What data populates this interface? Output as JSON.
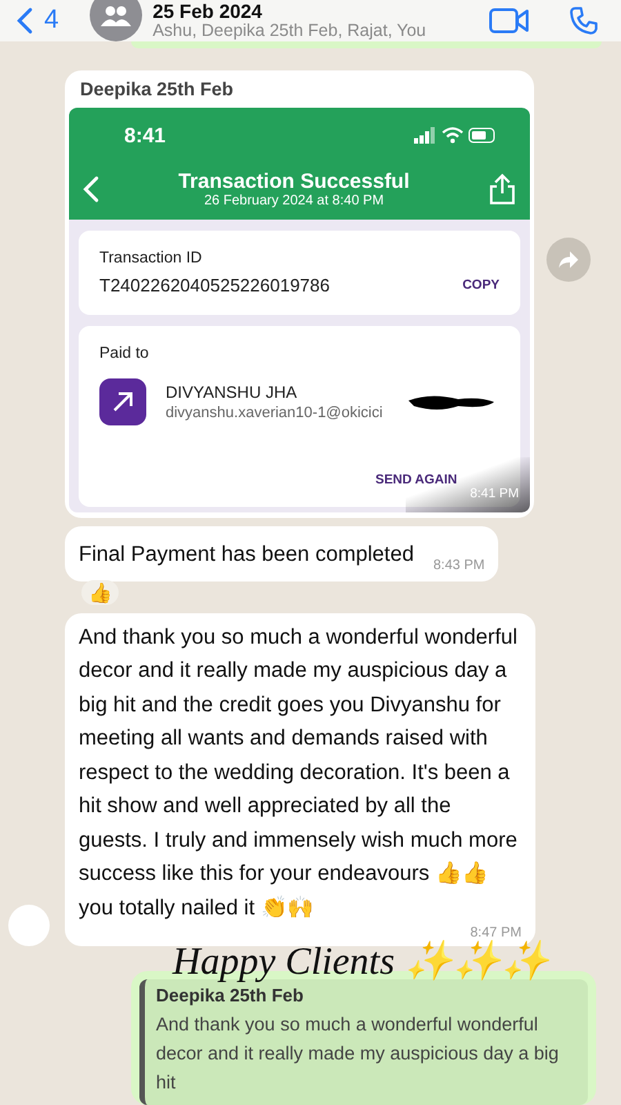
{
  "header": {
    "back_count": "4",
    "title": "25 Feb 2024",
    "subtitle": "Ashu, Deepika 25th Feb, Rajat, You"
  },
  "messages": [
    {
      "kind": "image",
      "sender": "Deepika 25th Feb",
      "time": "8:41 PM",
      "shot": {
        "clock": "8:41",
        "title": "Transaction Successful",
        "subtitle": "26 February 2024 at 8:40 PM",
        "id_label": "Transaction ID",
        "id_value": "T2402262040525226019786",
        "copy": "COPY",
        "paid_label": "Paid to",
        "payee": "DIVYANSHU JHA",
        "upi": "divyanshu.xaverian10-1@okicici",
        "send_again": "SEND AGAIN"
      }
    },
    {
      "kind": "text",
      "text": "Final Payment has been completed",
      "time": "8:43 PM",
      "reaction": "👍"
    },
    {
      "kind": "text",
      "text": "And thank you so much a wonderful wonderful decor and it really made my auspicious day a big hit and the credit goes you Divyanshu for meeting all wants and demands raised with respect to the wedding decoration. It's been a hit show and well appreciated by all the guests. I truly and immensely wish much more success like this for your endeavours 👍👍 you totally nailed it 👏🙌",
      "time": "8:47 PM",
      "avatar": true
    },
    {
      "kind": "quote",
      "sender": "Deepika 25th Feb",
      "text": "And thank you so much a wonderful wonderful decor and it really made my auspicious day a big hit"
    }
  ],
  "overlay": {
    "text": "Happy Clients ✨✨✨"
  }
}
